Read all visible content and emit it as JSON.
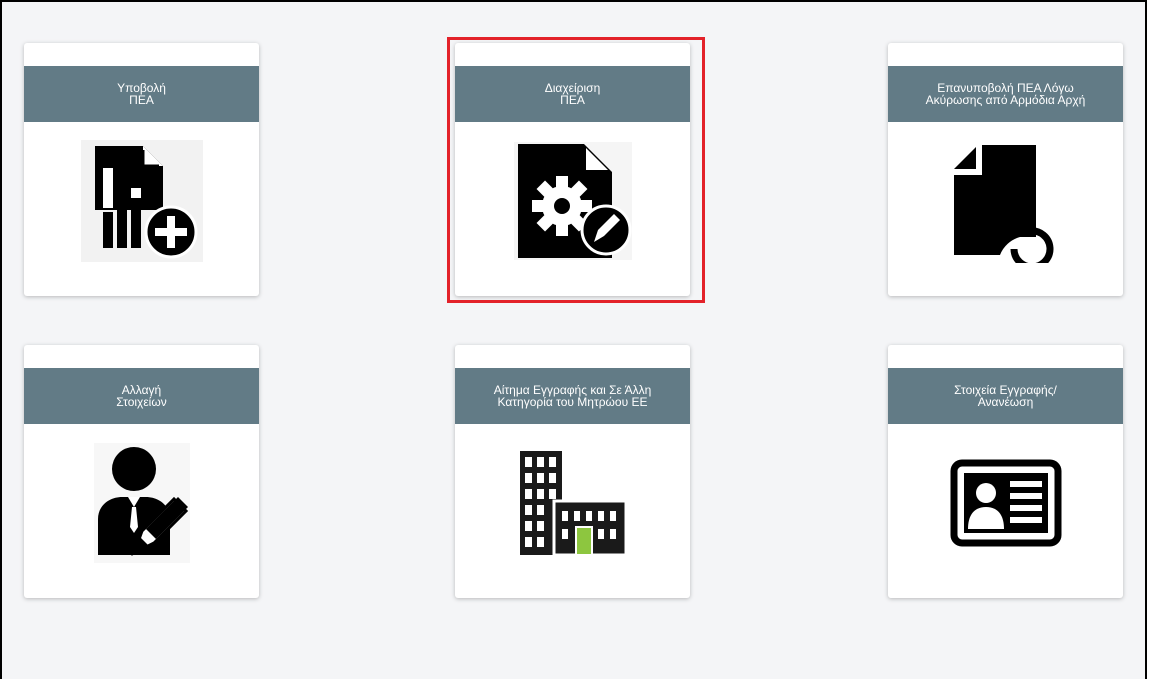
{
  "tiles": [
    {
      "title": "Υποβολή\nΠΕΑ",
      "icon": "document-chart-add-icon"
    },
    {
      "title": "Διαχείριση\nΠΕΑ",
      "icon": "document-gear-edit-icon",
      "selected": true
    },
    {
      "title": "Επανυποβολή ΠΕΑ Λόγω\nΑκύρωσης από Αρμόδια Αρχή",
      "icon": "document-resubmit-icon"
    },
    {
      "title": "Αλλαγή\nΣτοιχείων",
      "icon": "user-edit-icon"
    },
    {
      "title": "Αίτημα Εγγραφής και Σε Άλλη\nΚατηγορία του Μητρώου ΕΕ",
      "icon": "buildings-icon"
    },
    {
      "title": "Στοιχεία Εγγραφής/\nΑνανέωση",
      "icon": "id-card-icon"
    }
  ],
  "colors": {
    "header": "#627b86",
    "highlight": "#e3222a",
    "background": "#f4f5f7",
    "accent_green": "#8dc63f"
  }
}
